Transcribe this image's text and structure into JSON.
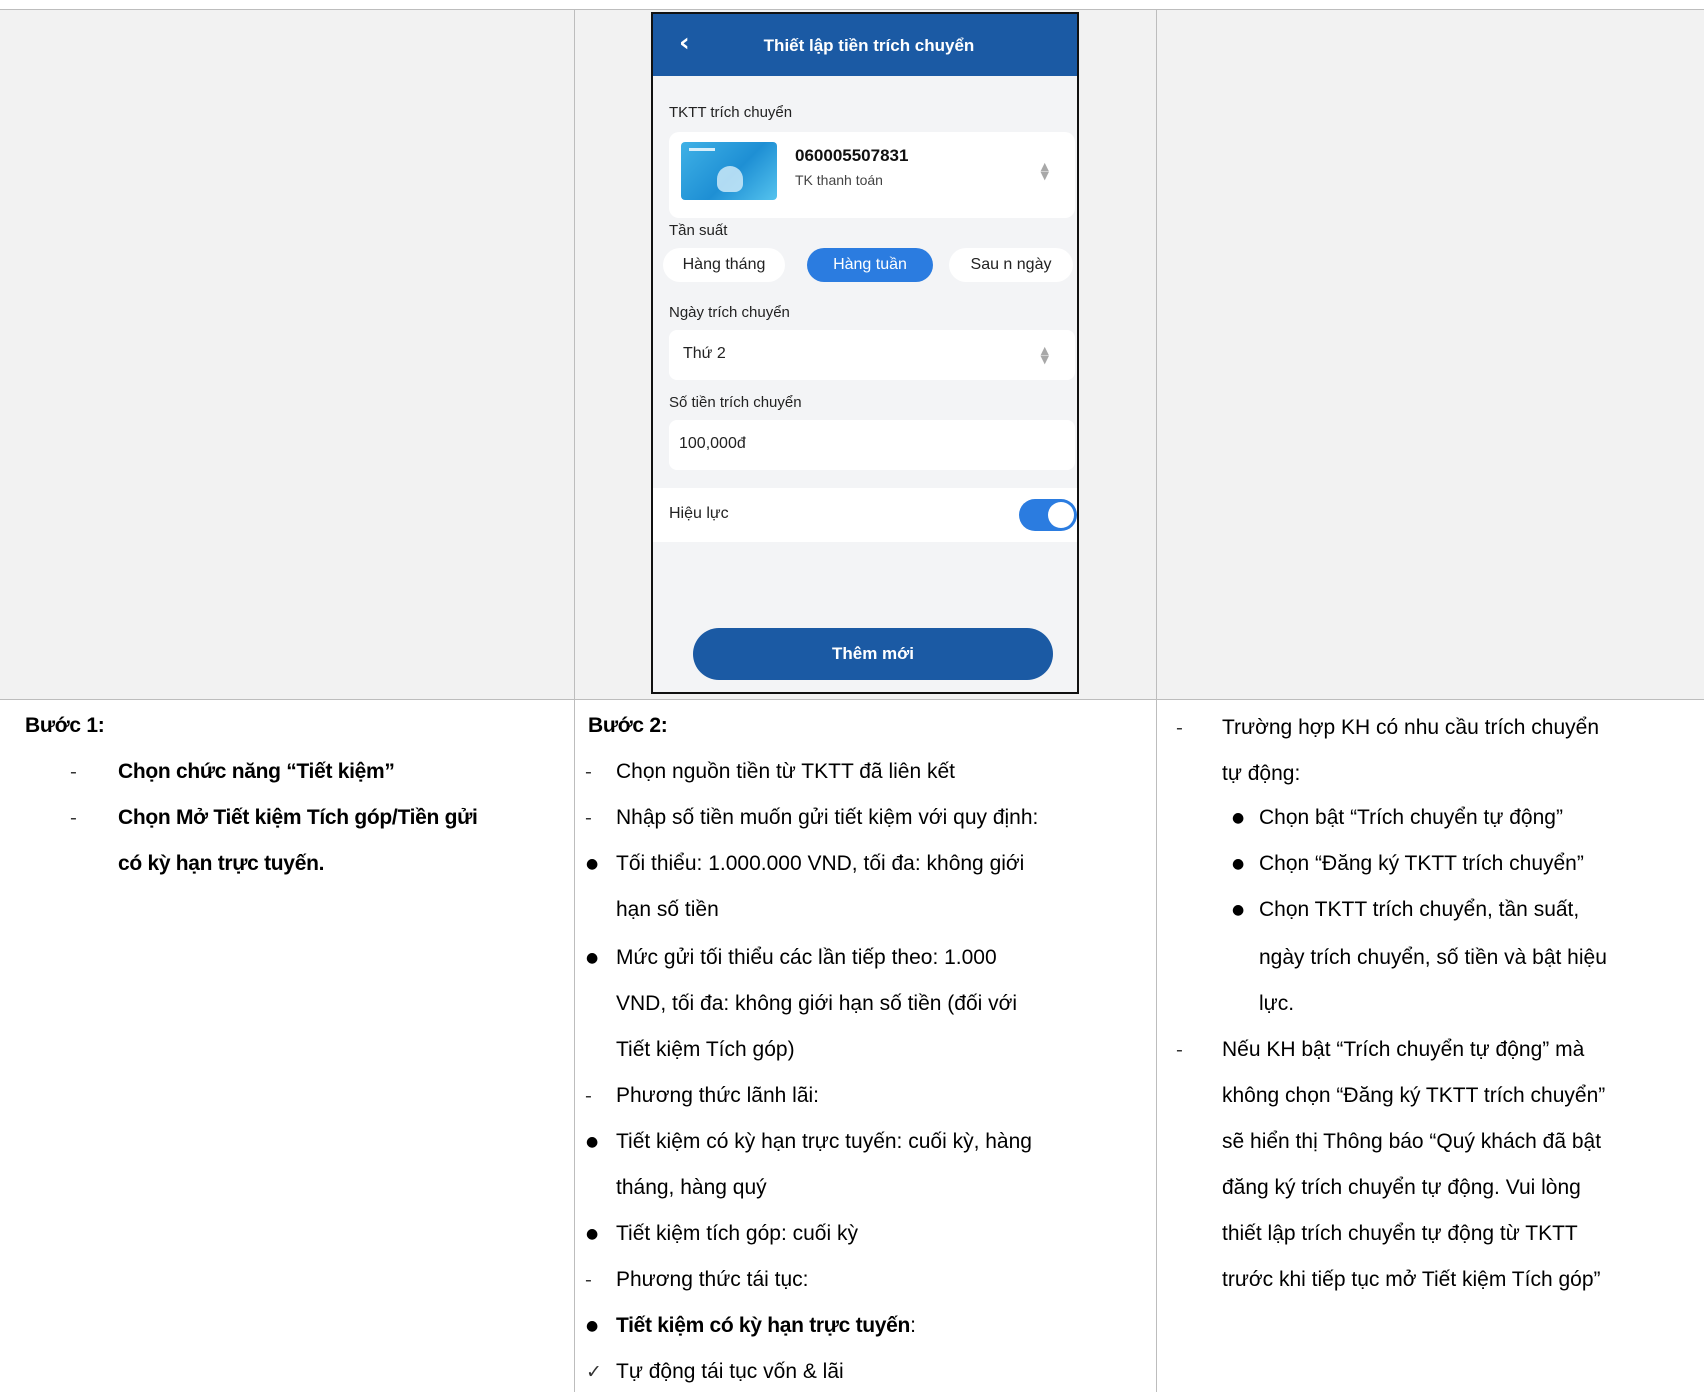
{
  "phone": {
    "header_title": "Thiết lập tiền trích chuyển",
    "account_label": "TKTT trích chuyển",
    "account_number": "060005507831",
    "account_type": "TK thanh toán",
    "frequency_label": "Tần suất",
    "frequency_options": [
      "Hàng tháng",
      "Hàng tuần",
      "Sau n ngày"
    ],
    "frequency_selected": "Hàng tuần",
    "day_label": "Ngày trích chuyển",
    "day_value": "Thứ 2",
    "amount_label": "Số tiền trích chuyển",
    "amount_value": "100,000đ",
    "effect_label": "Hiệu lực",
    "effect_on": true,
    "add_button": "Thêm mới",
    "accent": "#1b5aa4",
    "active": "#2b7ce0"
  },
  "step1": {
    "title": "Bước 1:",
    "lines": [
      "Chọn chức năng “Tiết kiệm”",
      "Chọn Mở Tiết kiệm Tích góp/Tiền gửi",
      "có kỳ hạn trực tuyến."
    ]
  },
  "step2": {
    "title": "Bước 2:",
    "lines": [
      "Chọn nguồn tiền từ TKTT đã liên kết",
      "Nhập số tiền muốn gửi tiết kiệm với quy định:",
      "Tối thiểu: 1.000.000 VND, tối đa: không giới",
      "hạn số tiền",
      "Mức gửi tối thiểu các lần tiếp theo: 1.000",
      "VND, tối đa: không giới hạn số tiền (đối với",
      "Tiết kiệm Tích góp)",
      "Phương thức lãnh lãi:",
      "Tiết kiệm có kỳ hạn trực tuyến: cuối kỳ, hàng",
      "tháng, hàng quý",
      "Tiết kiệm tích góp: cuối kỳ",
      "Phương thức tái tục:",
      "Tiết kiệm có kỳ hạn trực tuyến",
      ":",
      "Tự động tái tục vốn & lãi"
    ]
  },
  "step3": {
    "lines": [
      "Trường hợp KH có nhu cầu trích chuyển",
      "tự động:",
      "Chọn bật “Trích chuyển tự động”",
      "Chọn “Đăng ký TKTT trích chuyển”",
      "Chọn TKTT trích chuyển, tần suất,",
      "ngày trích chuyển, số tiền và bật hiệu",
      "lực.",
      "Nếu KH bật “Trích chuyển tự động” mà",
      "không chọn “Đăng ký TKTT trích chuyển”",
      "sẽ hiển thị Thông báo “Quý khách đã bật",
      "đăng ký trích chuyển tự động. Vui lòng",
      "thiết lập trích chuyển tự động từ TKTT",
      "trước khi tiếp tục mở Tiết kiệm Tích góp”"
    ]
  },
  "markers": {
    "dash": "-",
    "bullet": "●",
    "check": "✓"
  }
}
